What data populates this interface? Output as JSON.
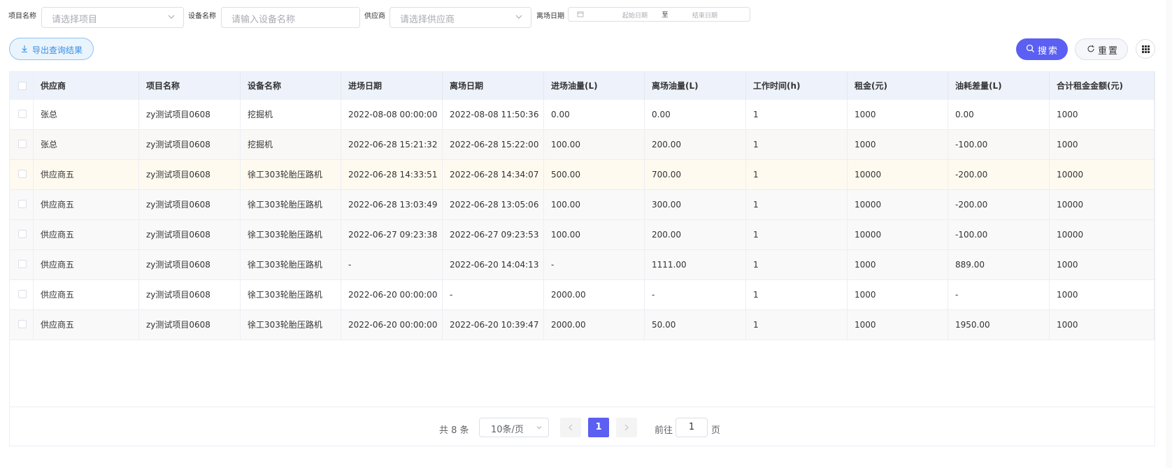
{
  "filters": {
    "project_label": "项目名称",
    "project_placeholder": "请选择项目",
    "device_label": "设备名称",
    "device_placeholder": "请输入设备名称",
    "supplier_label": "供应商",
    "supplier_placeholder": "请选择供应商",
    "exit_date_label": "离场日期",
    "start_placeholder": "起始日期",
    "range_separator": "至",
    "end_placeholder": "结束日期"
  },
  "actions": {
    "export_label": "导出查询结果",
    "search_label": "搜索",
    "reset_label": "重置"
  },
  "table": {
    "columns": [
      "供应商",
      "项目名称",
      "设备名称",
      "进场日期",
      "离场日期",
      "进场油量(L)",
      "离场油量(L)",
      "工作时间(h)",
      "租金(元)",
      "油耗差量(L)",
      "合计租金金额(元)"
    ],
    "rows": [
      [
        "张总",
        "zy测试项目0608",
        "挖掘机",
        "2022-08-08 00:00:00",
        "2022-08-08 11:50:36",
        "0.00",
        "0.00",
        "1",
        "1000",
        "0.00",
        "1000"
      ],
      [
        "张总",
        "zy测试项目0608",
        "挖掘机",
        "2022-06-28 15:21:32",
        "2022-06-28 15:22:00",
        "100.00",
        "200.00",
        "1",
        "1000",
        "-100.00",
        "1000"
      ],
      [
        "供应商五",
        "zy测试项目0608",
        "徐工303轮胎压路机",
        "2022-06-28 14:33:51",
        "2022-06-28 14:34:07",
        "500.00",
        "700.00",
        "1",
        "10000",
        "-200.00",
        "10000"
      ],
      [
        "供应商五",
        "zy测试项目0608",
        "徐工303轮胎压路机",
        "2022-06-28 13:03:49",
        "2022-06-28 13:05:06",
        "100.00",
        "300.00",
        "1",
        "10000",
        "-200.00",
        "10000"
      ],
      [
        "供应商五",
        "zy测试项目0608",
        "徐工303轮胎压路机",
        "2022-06-27 09:23:38",
        "2022-06-27 09:23:53",
        "100.00",
        "200.00",
        "1",
        "10000",
        "-100.00",
        "10000"
      ],
      [
        "供应商五",
        "zy测试项目0608",
        "徐工303轮胎压路机",
        "-",
        "2022-06-20 14:04:13",
        "-",
        "1111.00",
        "1",
        "1000",
        "889.00",
        "1000"
      ],
      [
        "供应商五",
        "zy测试项目0608",
        "徐工303轮胎压路机",
        "2022-06-20 00:00:00",
        "-",
        "2000.00",
        "-",
        "1",
        "1000",
        "-",
        "1000"
      ],
      [
        "供应商五",
        "zy测试项目0608",
        "徐工303轮胎压路机",
        "2022-06-20 00:00:00",
        "2022-06-20 10:39:47",
        "2000.00",
        "50.00",
        "1",
        "1000",
        "1950.00",
        "1000"
      ]
    ]
  },
  "pagination": {
    "total_text": "共 8 条",
    "page_size": "10条/页",
    "current_page": "1",
    "goto_label": "前往",
    "goto_value": "1",
    "goto_unit": "页"
  },
  "colors": {
    "primary": "#5b5ff2",
    "export_text": "#3a8ee6",
    "header_bg": "#eef2fb",
    "highlight_row_bg": "#fffaf0"
  },
  "icons": {
    "export": "download-icon",
    "search": "search-icon",
    "reset": "refresh-icon",
    "columns": "grid-icon",
    "select": "chevron-down-icon",
    "calendar": "calendar-icon",
    "prev": "chevron-left-icon",
    "next": "chevron-right-icon"
  }
}
